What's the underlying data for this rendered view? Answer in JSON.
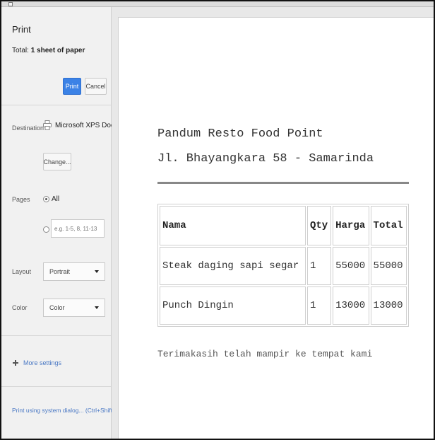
{
  "print_panel": {
    "title": "Print",
    "summary_prefix": "Total: ",
    "summary_count": "1 sheet of paper",
    "print_label": "Print",
    "cancel_label": "Cancel",
    "destination": {
      "label": "Destination",
      "value": "Microsoft XPS Docume...",
      "change_label": "Change..."
    },
    "pages": {
      "label": "Pages",
      "all_label": "All",
      "range_placeholder": "e.g. 1-5, 8, 11-13"
    },
    "layout": {
      "label": "Layout",
      "selected": "Portrait"
    },
    "color": {
      "label": "Color",
      "selected": "Color"
    },
    "more_settings_label": "More settings",
    "system_dialog_label": "Print using system dialog... (Ctrl+Shift+P)"
  },
  "receipt": {
    "name": "Pandum Resto Food Point",
    "address": "Jl. Bhayangkara 58 - Samarinda",
    "columns": [
      "Nama",
      "Qty",
      "Harga",
      "Total"
    ],
    "rows": [
      [
        "Steak daging sapi segar",
        "1",
        "55000",
        "55000"
      ],
      [
        "Punch Dingin",
        "1",
        "13000",
        "13000"
      ]
    ],
    "footer": "Terimakasih telah mampir ke tempat kami"
  },
  "colors": {
    "print_button": "#3b82e6",
    "link": "#4a78c4",
    "sidebar_bg": "#f1f1f1"
  },
  "icons": [
    "printer-icon",
    "radio-icon",
    "chevron-down-icon",
    "plus-icon"
  ]
}
